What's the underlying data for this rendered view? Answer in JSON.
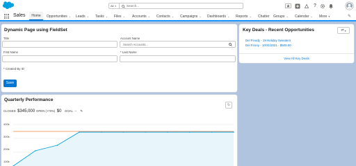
{
  "header": {
    "search_scope": "All",
    "search_placeholder": "Search...",
    "icons": [
      "plus-icon",
      "help-icon",
      "gear-icon",
      "bell-icon",
      "user-avatar"
    ]
  },
  "nav": {
    "app_name": "Sales",
    "tabs": [
      {
        "label": "Home",
        "active": true,
        "dropdown": false
      },
      {
        "label": "Opportunities",
        "dropdown": true
      },
      {
        "label": "Leads",
        "dropdown": true
      },
      {
        "label": "Tasks",
        "dropdown": true
      },
      {
        "label": "Files",
        "dropdown": true
      },
      {
        "label": "Accounts",
        "dropdown": true
      },
      {
        "label": "Contacts",
        "dropdown": true
      },
      {
        "label": "Campaigns",
        "dropdown": true
      },
      {
        "label": "Dashboards",
        "dropdown": true
      },
      {
        "label": "Reports",
        "dropdown": true
      },
      {
        "label": "Chatter",
        "dropdown": false
      },
      {
        "label": "Groups",
        "dropdown": true
      },
      {
        "label": "Calendar",
        "dropdown": true
      },
      {
        "label": "More",
        "dropdown": true
      }
    ]
  },
  "form_card": {
    "title": "Dynamic Page using FieldSet",
    "fields": {
      "title_label": "Title",
      "account_label": "Account Name",
      "account_placeholder": "Search Accounts...",
      "first_name_label": "First Name",
      "last_name_label": "* Last Name",
      "created_by_label": "* Created By ID"
    },
    "save_label": "Save"
  },
  "deals_card": {
    "title": "Key Deals - Recent Opportunities",
    "deals": [
      "Del Finody - 19 Holiday Sweaters",
      "Del Firony - 10/31/2021 - $500.00"
    ],
    "view_all": "View All Key Deals"
  },
  "performance_card": {
    "title": "Quarterly Performance",
    "closed_label": "CLOSED",
    "closed_value": "$345,000",
    "open_label": "OPEN (>70%)",
    "open_value": "$0",
    "goal_label": "GOAL",
    "goal_value": "--"
  },
  "chart_data": {
    "type": "line",
    "y_tick_labels": [
      "400k",
      "300k",
      "200k",
      "100k"
    ],
    "ylim": [
      100000,
      400000
    ],
    "goal_line_value": 350000,
    "series": [
      {
        "values": [
          100000,
          210000,
          250000,
          345000,
          345000,
          345000,
          345000,
          345000,
          345000,
          345000,
          345000
        ]
      }
    ]
  },
  "colors": {
    "brand_blue": "#0176d3",
    "goal_line": "#f5a16d",
    "closed_line": "#00a1e0",
    "page_bg": "#b0c4df"
  }
}
